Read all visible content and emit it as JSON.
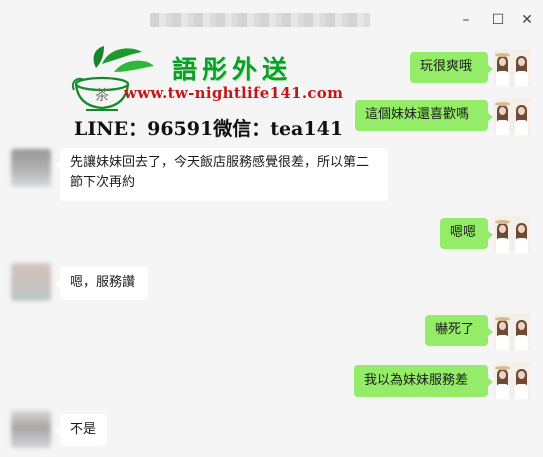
{
  "window": {
    "controls": {
      "minimize": "–",
      "maximize": "☐",
      "close": "✕"
    }
  },
  "watermark": {
    "title": "語彤外送",
    "url": "www.tw-nightlife141.com",
    "contact": "LINE：96591微信：tea141",
    "logo_char": "茶"
  },
  "messages": [
    {
      "side": "right",
      "text": "玩很爽哦"
    },
    {
      "side": "right",
      "text": "這個妹妹還喜歡嗎"
    },
    {
      "side": "left",
      "text": "先讓妹妹回去了，今天飯店服務感覺很差，所以第二節下次再約"
    },
    {
      "side": "right",
      "text": "嗯嗯"
    },
    {
      "side": "left",
      "text": "嗯，服務讚"
    },
    {
      "side": "right",
      "text": "嚇死了"
    },
    {
      "side": "right",
      "text": "我以為妹妹服務差"
    },
    {
      "side": "left",
      "text": "不是"
    }
  ],
  "colors": {
    "bubble_out": "#95ec69",
    "bubble_in": "#ffffff",
    "background": "#f5f5f5"
  }
}
